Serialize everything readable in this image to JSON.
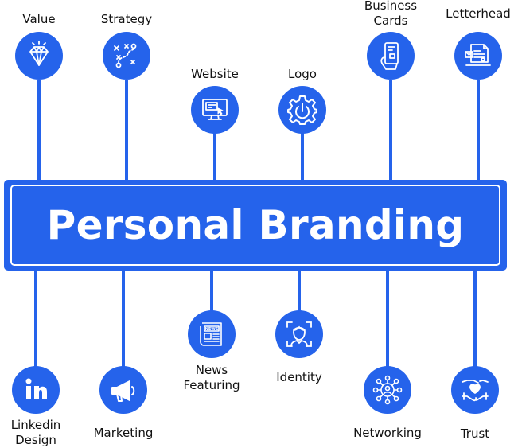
{
  "title": "Personal Branding",
  "colors": {
    "accent": "#2563eb",
    "text": "#111111",
    "background": "#ffffff"
  },
  "top_nodes": [
    {
      "label": "Value",
      "icon": "diamond-icon"
    },
    {
      "label": "Strategy",
      "icon": "strategy-icon"
    },
    {
      "label": "Website",
      "icon": "website-icon"
    },
    {
      "label": "Logo",
      "icon": "logo-gear-icon"
    },
    {
      "label": "Business\nCards",
      "icon": "business-card-icon"
    },
    {
      "label": "Letterhead",
      "icon": "letterhead-icon"
    }
  ],
  "bottom_nodes": [
    {
      "label": "Linkedin\nDesign",
      "icon": "linkedin-icon"
    },
    {
      "label": "Marketing",
      "icon": "megaphone-icon"
    },
    {
      "label": "News\nFeaturing",
      "icon": "newspaper-icon"
    },
    {
      "label": "Identity",
      "icon": "identity-icon"
    },
    {
      "label": "Networking",
      "icon": "network-icon"
    },
    {
      "label": "Trust",
      "icon": "handshake-heart-icon"
    }
  ]
}
